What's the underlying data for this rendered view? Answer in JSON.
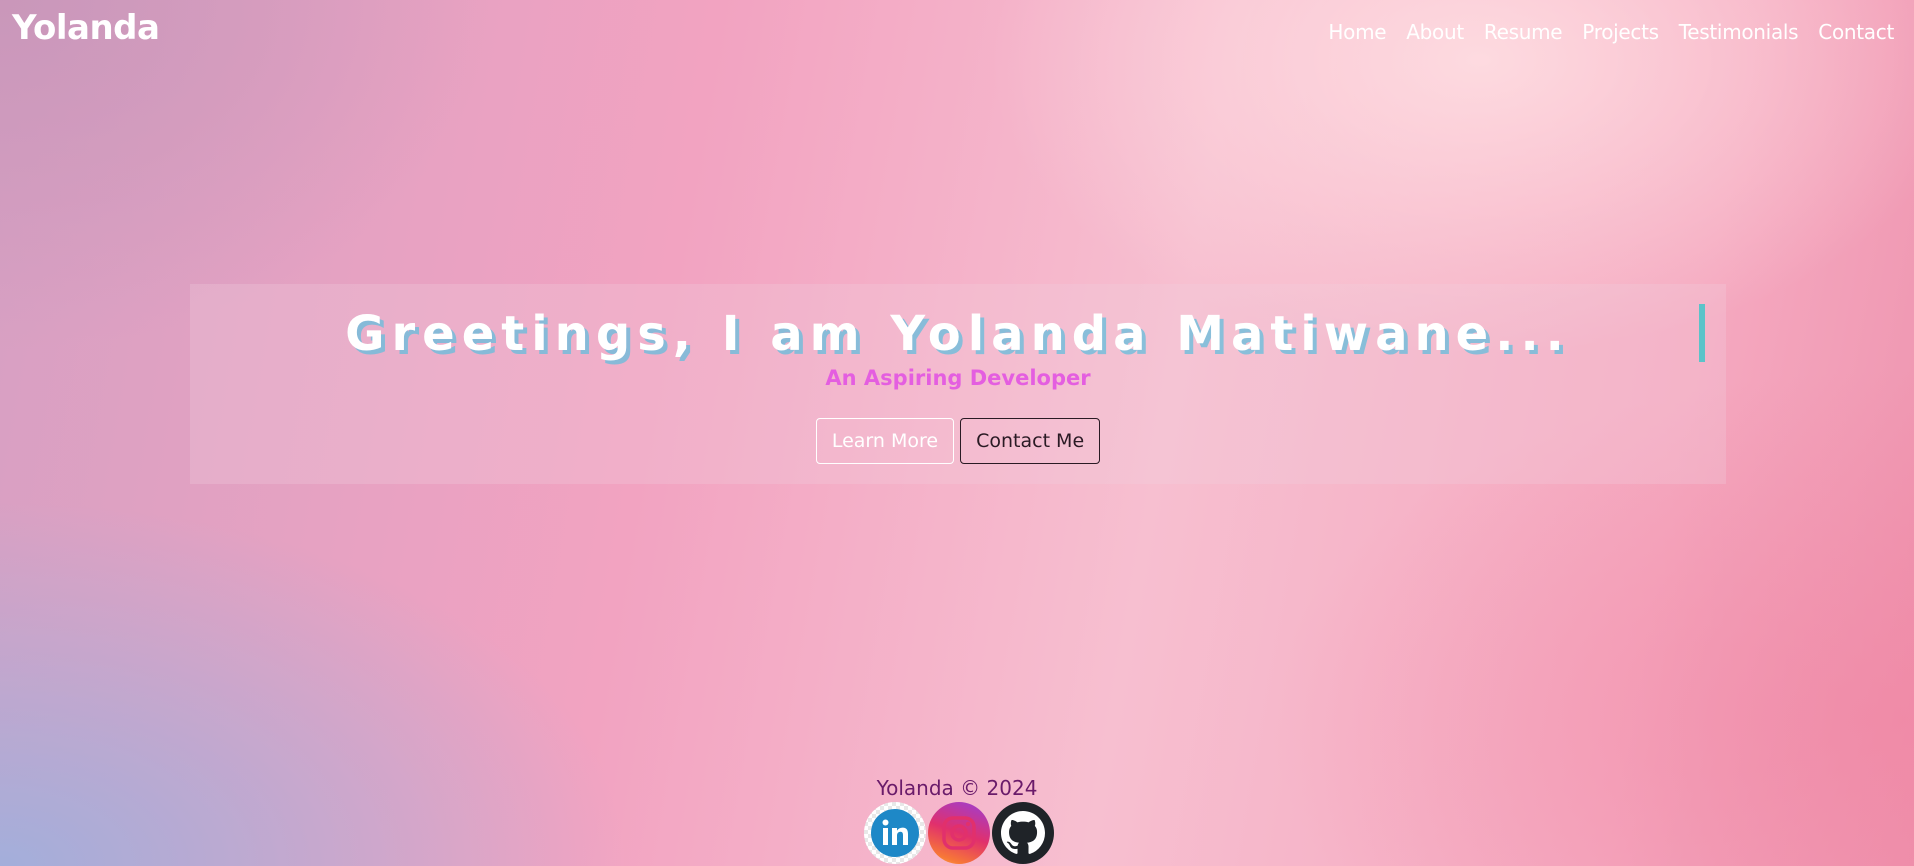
{
  "header": {
    "brand": "Yolanda",
    "nav": [
      "Home",
      "About",
      "Resume",
      "Projects",
      "Testimonials",
      "Contact"
    ]
  },
  "hero": {
    "title": "Greetings, I am Yolanda Matiwane...",
    "subtitle": "An Aspiring Developer",
    "buttons": {
      "learn_more": "Learn More",
      "contact_me": "Contact Me"
    }
  },
  "footer": {
    "copyright": "Yolanda © 2024",
    "socials": [
      {
        "icon": "linkedin-icon",
        "color": "#1e88c7"
      },
      {
        "icon": "instagram-icon",
        "color": "#e1306c"
      },
      {
        "icon": "github-icon",
        "color": "#1f2328"
      }
    ]
  },
  "colors": {
    "subtitle": "#e45ee0",
    "cursor": "#5bc3c9",
    "footer_text": "#6a1b6a"
  }
}
